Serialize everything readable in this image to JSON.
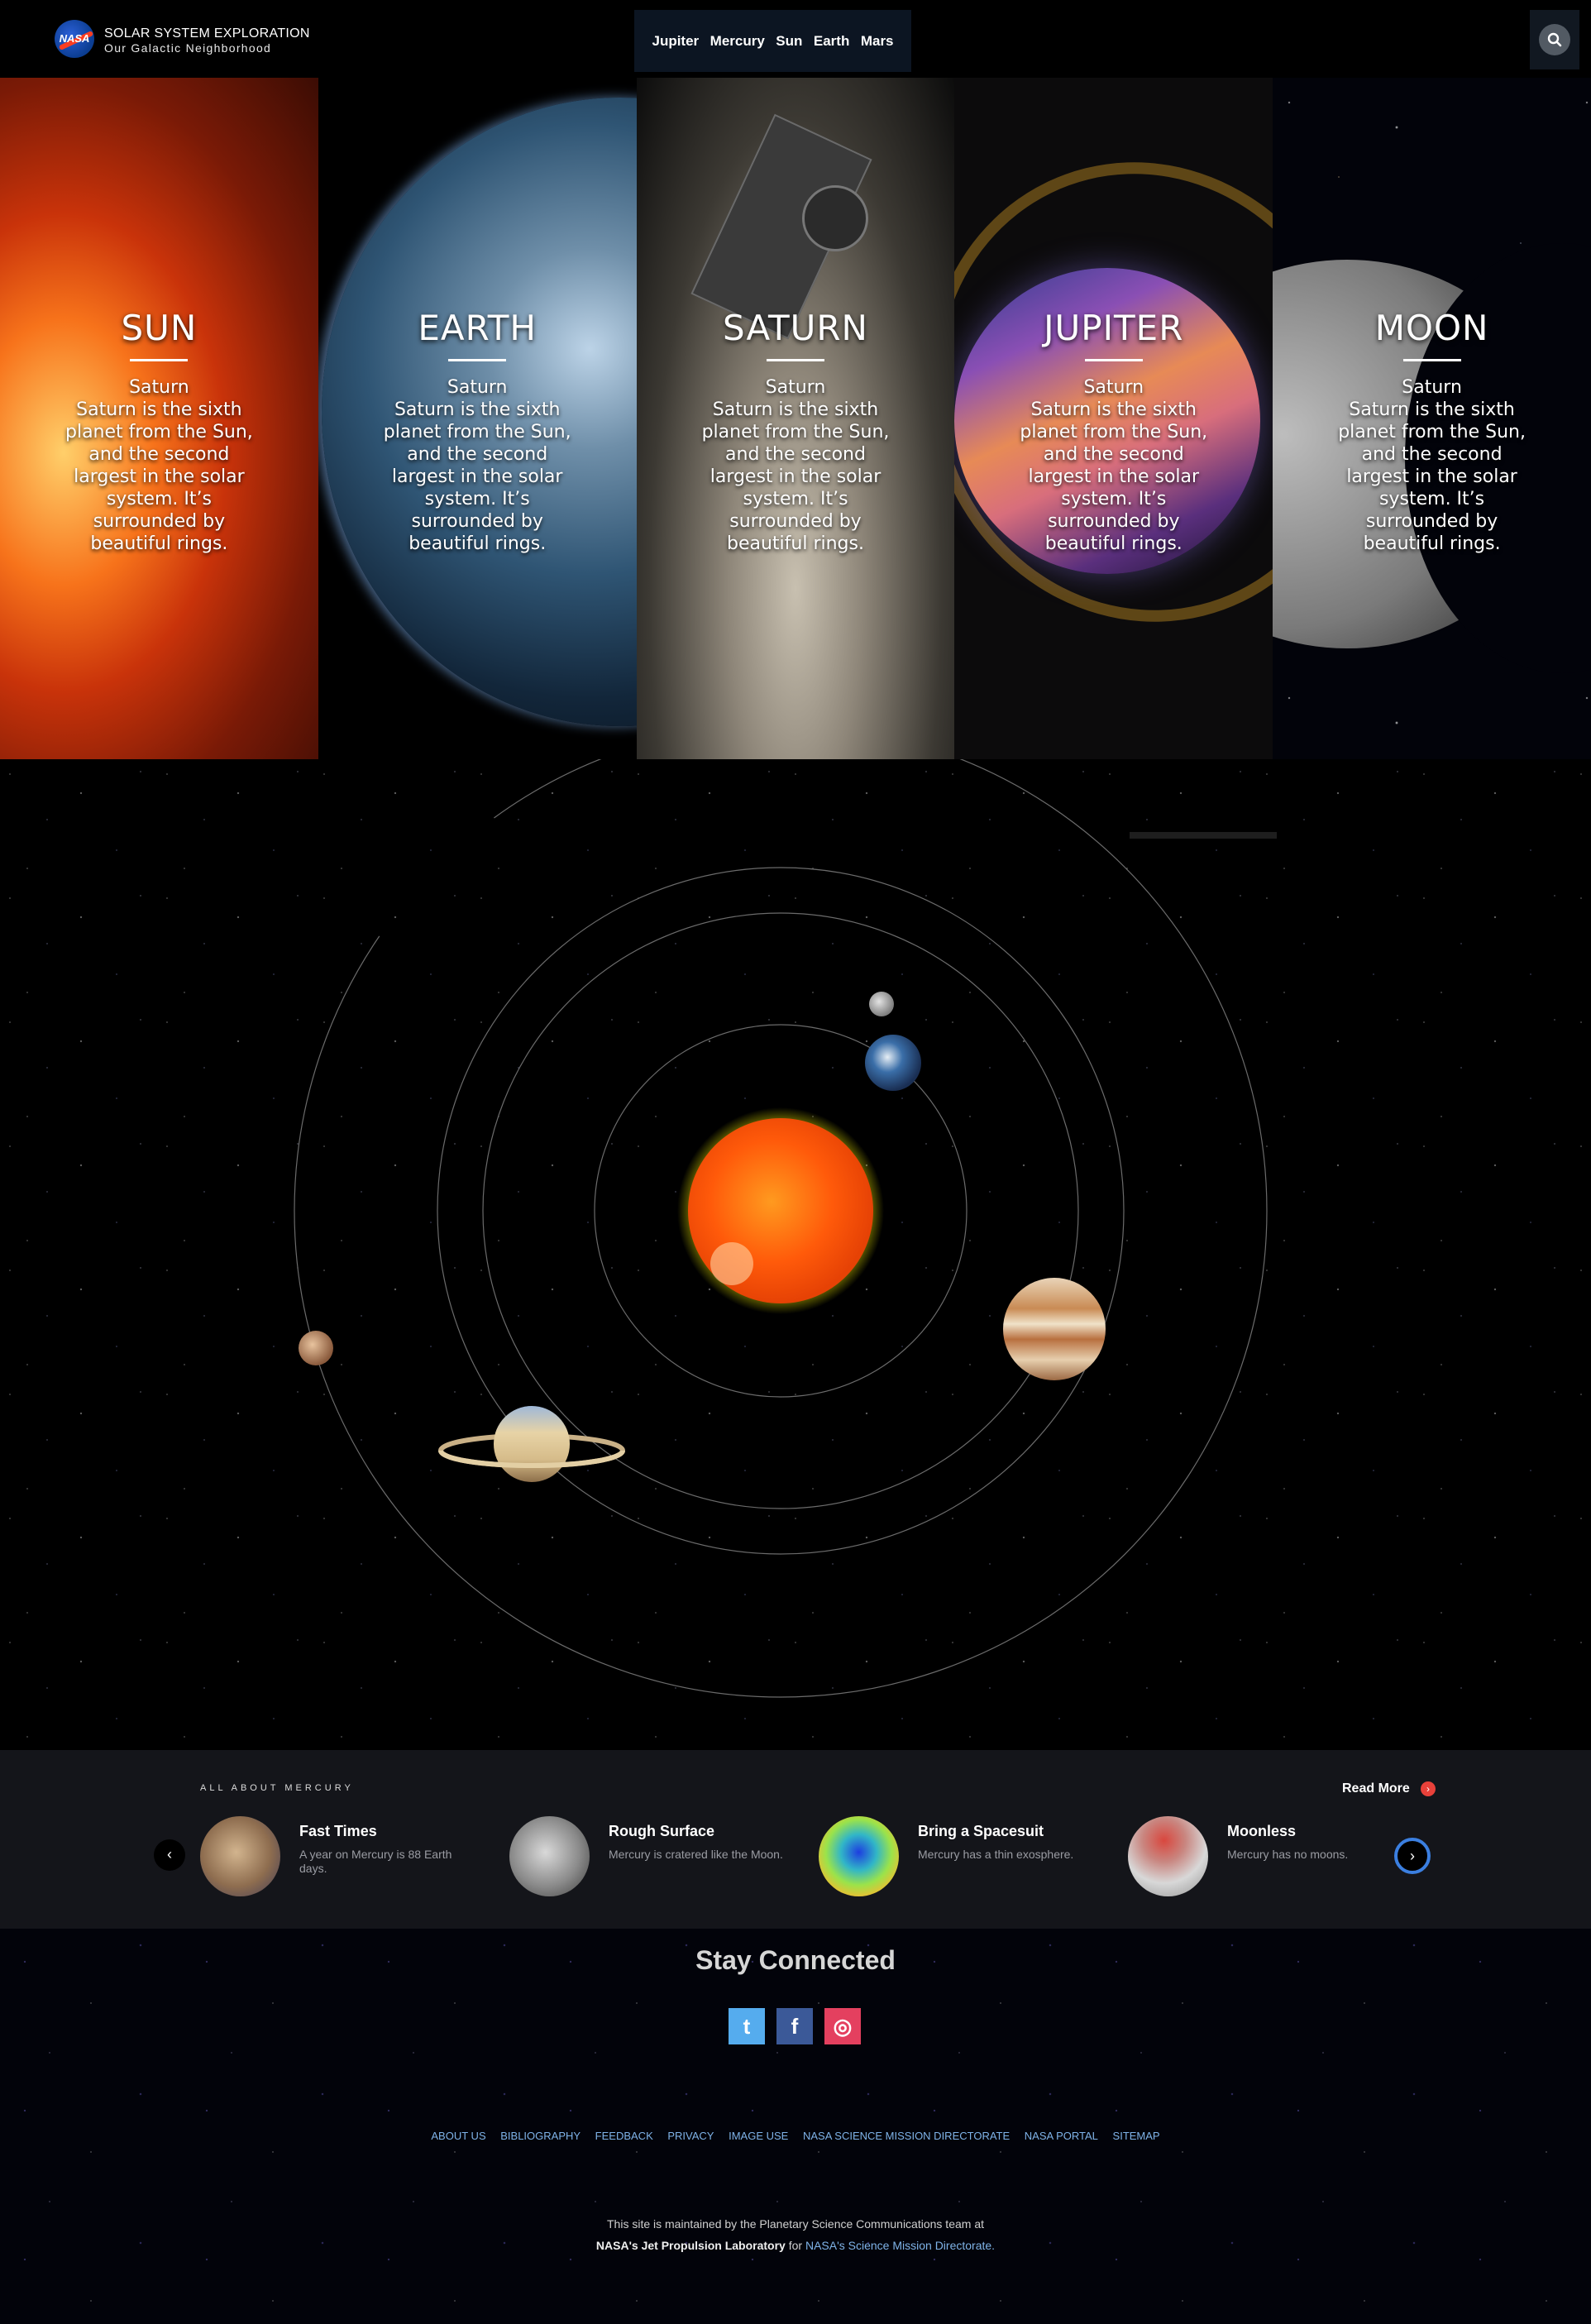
{
  "brand": {
    "logo_text": "NASA",
    "title": "SOLAR SYSTEM EXPLORATION",
    "subtitle": "Our Galactic Neighborhood"
  },
  "nav": {
    "items": [
      "Jupiter",
      "Mercury",
      "Sun",
      "Earth",
      "Mars"
    ]
  },
  "search": {
    "icon": "search-icon"
  },
  "hero": {
    "panels": [
      {
        "title": "SUN",
        "subtitle": "Saturn",
        "text": "Saturn is the sixth planet from the Sun, and the second largest in the solar system. It’s surrounded by beautiful rings."
      },
      {
        "title": "EARTH",
        "subtitle": "Saturn",
        "text": "Saturn is the sixth planet from the Sun, and the second largest in the solar system. It’s surrounded by beautiful rings."
      },
      {
        "title": "SATURN",
        "subtitle": "Saturn",
        "text": "Saturn is the sixth planet from the Sun, and the second largest in the solar system. It’s surrounded by beautiful rings."
      },
      {
        "title": "JUPITER",
        "subtitle": "Saturn",
        "text": "Saturn is the sixth planet from the Sun, and the second largest in the solar system. It’s surrounded by beautiful rings."
      },
      {
        "title": "MOON",
        "subtitle": "Saturn",
        "text": "Saturn is the sixth planet from the Sun, and the second largest in the solar system. It’s surrounded by beautiful rings."
      }
    ]
  },
  "mercury": {
    "label": "ALL ABOUT MERCURY",
    "read_more": "Read More",
    "cards": [
      {
        "title": "Fast Times",
        "desc": "A year on Mercury is 88 Earth days."
      },
      {
        "title": "Rough Surface",
        "desc": "Mercury is cratered like the Moon."
      },
      {
        "title": "Bring a Spacesuit",
        "desc": "Mercury has a thin exosphere."
      },
      {
        "title": "Moonless",
        "desc": "Mercury has no moons."
      }
    ],
    "prev": "‹",
    "next": "›"
  },
  "footer": {
    "heading": "Stay Connected",
    "social": {
      "twitter": "t",
      "facebook": "f",
      "instagram": "◎"
    },
    "links": [
      "ABOUT US",
      "BIBLIOGRAPHY",
      "FEEDBACK",
      "PRIVACY",
      "IMAGE USE",
      "NASA SCIENCE MISSION DIRECTORATE",
      "NASA PORTAL",
      "SITEMAP"
    ],
    "maintained_line": "This site is maintained by the Planetary Science Communications team at",
    "jpl": "NASA's Jet Propulsion Laboratory",
    "for": " for ",
    "smd": "NASA's Science Mission Directorate."
  },
  "colors": {
    "accent_blue": "#3b7fe0",
    "read_more_red": "#e8413a",
    "link_blue": "#7fb3e8"
  }
}
